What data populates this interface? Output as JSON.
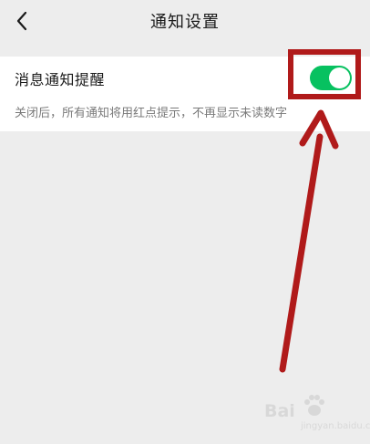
{
  "nav": {
    "title": "通知设置",
    "back_icon": "chevron-left-icon"
  },
  "setting": {
    "label": "消息通知提醒",
    "description": "关闭后，所有通知将用红点提示，不再显示未读数字",
    "toggle_on": true
  },
  "colors": {
    "background": "#ededed",
    "card": "#ffffff",
    "toggle_on": "#07c160",
    "annotation": "#b01a1a"
  },
  "watermark": {
    "brand": "Bai",
    "sub": "jingyan.baidu.com"
  }
}
